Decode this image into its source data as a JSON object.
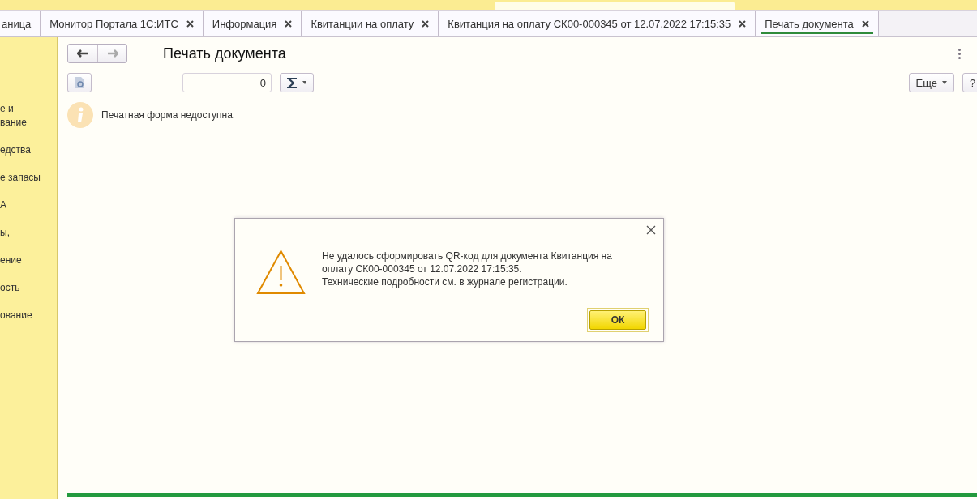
{
  "tabs": [
    {
      "label": "аница",
      "closable": false,
      "selected": false
    },
    {
      "label": "Монитор Портала 1С:ИТС",
      "closable": true,
      "selected": false
    },
    {
      "label": "Информация",
      "closable": true,
      "selected": false
    },
    {
      "label": "Квитанции на оплату",
      "closable": true,
      "selected": false
    },
    {
      "label": "Квитанция на оплату СК00-000345 от 12.07.2022 17:15:35",
      "closable": true,
      "selected": false
    },
    {
      "label": "Печать документа",
      "closable": true,
      "selected": true
    }
  ],
  "sidebar": {
    "items": [
      {
        "lines": [
          "е и",
          "вание"
        ]
      },
      {
        "lines": [
          "едства"
        ]
      },
      {
        "lines": [
          "е запасы"
        ]
      },
      {
        "lines": [
          "А"
        ]
      },
      {
        "lines": [
          "ы,"
        ]
      },
      {
        "lines": [
          "ение"
        ]
      },
      {
        "lines": [
          "ость"
        ]
      },
      {
        "lines": [
          "ование"
        ]
      }
    ]
  },
  "form": {
    "title": "Печать документа",
    "sum_field": {
      "value": "0"
    },
    "more_button": "Еще",
    "help_button": "?",
    "message": "Печатная форма недоступна."
  },
  "dialog": {
    "message_lines": [
      "Не удалось сформировать QR-код для документа Квитанция на",
      "оплату СК00-000345 от 12.07.2022 17:15:35.",
      "Технические подробности см. в журнале регистрации."
    ],
    "ok_button": "ОК"
  }
}
